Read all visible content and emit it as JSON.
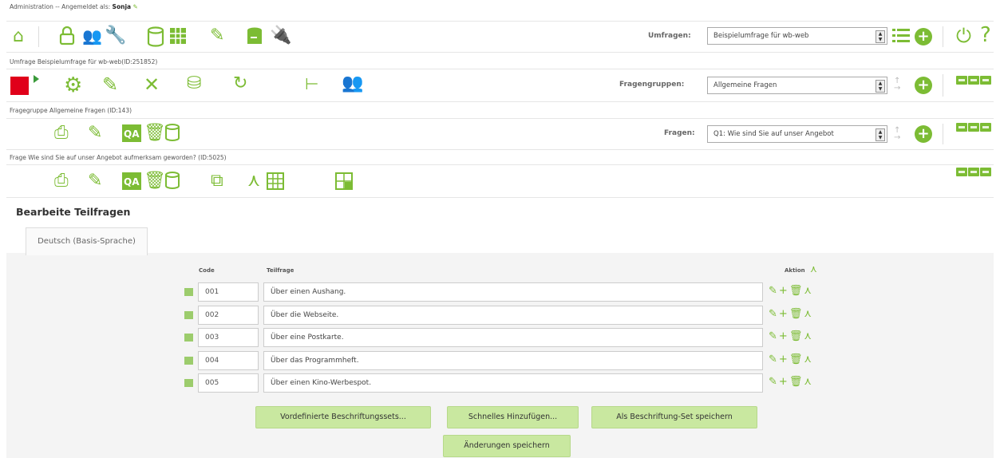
{
  "breadcrumbs": {
    "admin": "Administration",
    "logged_in_prefix": "-- Angemeldet als:",
    "user": "Sonja",
    "survey": "Umfrage Beispielumfrage für wb-web(ID:251852)",
    "group": "Fragegruppe  Allgemeine Fragen (ID:143)",
    "question": "Frage Wie sind Sie auf unser Angebot aufmerksam geworden? (ID:5025)"
  },
  "toolbars": {
    "surveys": {
      "label": "Umfragen:",
      "selected": "Beispielumfrage für wb-web"
    },
    "groups": {
      "label": "Fragengruppen:",
      "selected": "Allgemeine Fragen"
    },
    "questions": {
      "label": "Fragen:",
      "selected": "Q1: Wie sind Sie auf unser Angebot"
    }
  },
  "section_title": "Bearbeite Teilfragen",
  "language_tab": "Deutsch (Basis-Sprache)",
  "columns": {
    "code": "Code",
    "subquestion": "Teilfrage",
    "actions": "Aktion"
  },
  "rows": [
    {
      "code": "001",
      "text": "Über einen Aushang."
    },
    {
      "code": "002",
      "text": "Über die Webseite."
    },
    {
      "code": "003",
      "text": "Über eine Postkarte."
    },
    {
      "code": "004",
      "text": "Über das Programmheft."
    },
    {
      "code": "005",
      "text": "Über einen Kino-Werbespot."
    }
  ],
  "buttons": {
    "predefined": "Vordefinierte Beschriftungssets...",
    "quick_add": "Schnelles Hinzufügen...",
    "save_as_set": "Als Beschriftung-Set speichern",
    "save_changes": "Änderungen speichern"
  },
  "icons": {
    "top": [
      "home-icon",
      "lock-icon",
      "users-icon",
      "wrench-icon",
      "database-icon",
      "grid-icon",
      "brush-icon",
      "db-export-icon",
      "plugin-icon",
      "list-icon",
      "add-icon",
      "power-icon",
      "help-icon"
    ],
    "survey": [
      "stop-icon",
      "play-icon",
      "gear-icon",
      "pencil-icon",
      "tools-icon",
      "tokens-icon",
      "responses-icon",
      "expression-icon",
      "participants-icon"
    ]
  },
  "colors": {
    "accent": "#7cbc34",
    "button": "#c9e8a0",
    "stop": "#e0001a"
  }
}
